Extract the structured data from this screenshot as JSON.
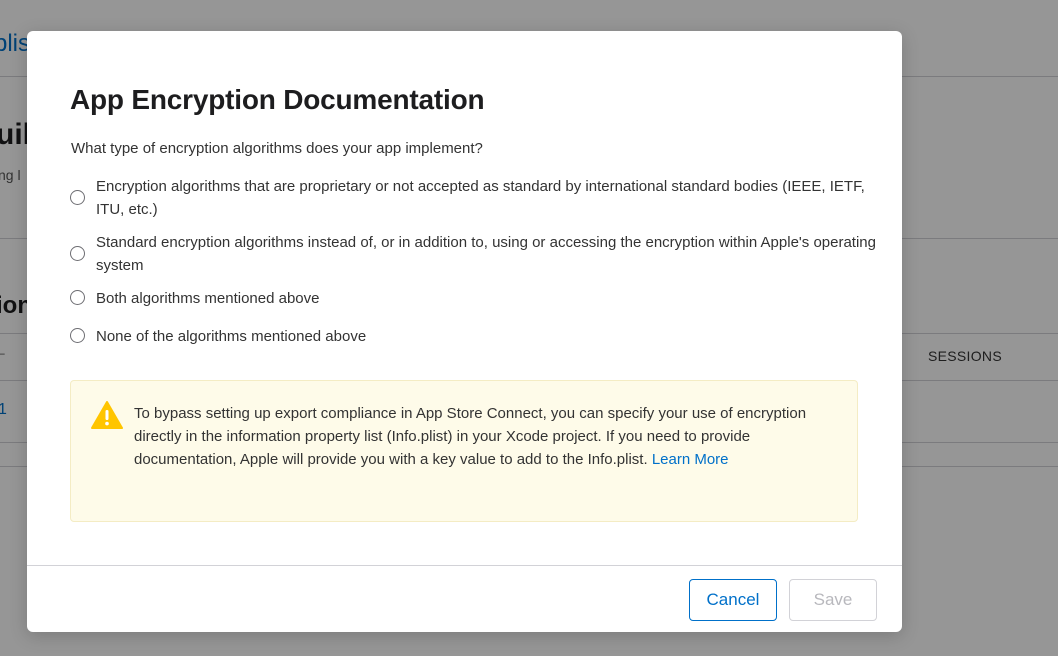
{
  "background": {
    "link_text": "plist",
    "heading_text": "uil",
    "sub_text": "ng l",
    "section_text": "ion",
    "column_dash": "–",
    "sessions_header": "SESSIONS",
    "row_value": "1"
  },
  "modal": {
    "title": "App Encryption Documentation",
    "question": "What type of encryption algorithms does your app implement?",
    "options": [
      {
        "label": "Encryption algorithms that are proprietary or not accepted as standard by international standard bodies (IEEE, IETF, ITU, etc.)",
        "selected": false
      },
      {
        "label": "Standard encryption algorithms instead of, or in addition to, using or accessing the encryption within Apple's operating system",
        "selected": false
      },
      {
        "label": "Both algorithms mentioned above",
        "selected": false
      },
      {
        "label": "None of the algorithms mentioned above",
        "selected": false
      }
    ],
    "notice": {
      "icon": "warning-icon",
      "text": "To bypass setting up export compliance in App Store Connect, you can specify your use of encryption directly in the information property list (Info.plist) in your Xcode project. If you need to provide documentation, Apple will provide you with a key value to add to the Info.plist.",
      "link_text": "Learn More"
    },
    "buttons": {
      "cancel_label": "Cancel",
      "save_label": "Save",
      "save_disabled": true
    }
  },
  "colors": {
    "accent": "#0070c9",
    "notice_bg": "#fefbe9",
    "warning": "#ffc500"
  }
}
